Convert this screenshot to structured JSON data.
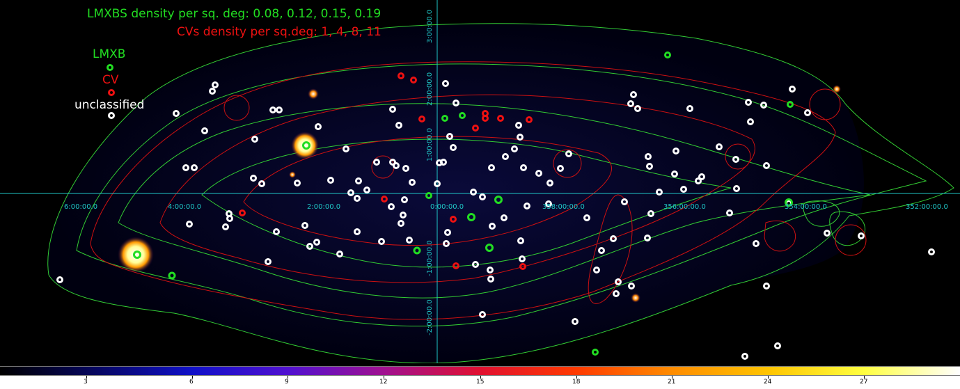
{
  "legend": {
    "lmxb_density": "LMXBS density per sq. deg: 0.08, 0.12, 0.15, 0.19",
    "cv_density": "CVs density per sq.deg: 1, 4, 8, 11",
    "items": {
      "lmxb": "LMXB",
      "cv": "CV",
      "unclassified": "unclassified"
    }
  },
  "colors": {
    "lmxb": "#22dd22",
    "cv": "#ee1111",
    "unclassified": "#ffffff",
    "axis": "#20c8c8",
    "contour_lmxb": "#33cc33",
    "contour_cv": "#cc1111"
  },
  "axes": {
    "x_ticks": [
      "6:00:00.0",
      "4:00:00.0",
      "2:00:00.0",
      "0:00:00.0",
      "358:00:00.0",
      "356:00:00.0",
      "354:00:00.0",
      "352:00:00.0"
    ],
    "y_ticks": [
      "3:00:00.0",
      "2:00:00.0",
      "1:00:00.0",
      "-1:00:00.0",
      "-2:00:00.0"
    ]
  },
  "colorbar": {
    "ticks": [
      "3",
      "6",
      "9",
      "12",
      "15",
      "18",
      "21",
      "24",
      "27"
    ]
  }
}
